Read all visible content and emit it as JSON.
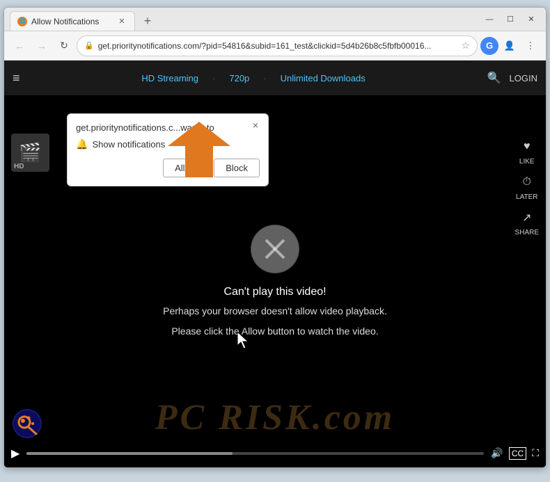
{
  "browser": {
    "tab": {
      "title": "Allow Notifications",
      "favicon": "🌐"
    },
    "new_tab_label": "+",
    "window_controls": {
      "minimize": "—",
      "maximize": "☐",
      "close": "✕"
    },
    "nav": {
      "back": "←",
      "forward": "→",
      "refresh": "↻",
      "address": "get.prioritynotifications.com/?pid=54816&subid=161_test&clickid=5d4b26b8c5fbfb00016...",
      "star": "☆",
      "g_label": "G",
      "profile": "👤",
      "menu": "⋮"
    }
  },
  "site": {
    "hamburger": "≡",
    "features": [
      {
        "label": "HD Streaming"
      },
      {
        "sep": "·"
      },
      {
        "label": "720p"
      },
      {
        "sep": "·"
      },
      {
        "label": "Unlimited Downloads"
      }
    ],
    "search_label": "LOGIN",
    "right_icons": [
      {
        "name": "LIKE"
      },
      {
        "name": "LATER"
      },
      {
        "name": "SHARE"
      }
    ]
  },
  "video": {
    "cant_play": "Can't play this video!",
    "subtext_1": "Perhaps your browser doesn't allow video playback.",
    "subtext_2": "Please click the Allow button to watch the video.",
    "controls": {
      "play": "▶",
      "progress_pct": 45
    }
  },
  "notification_popup": {
    "site_name": "get.prioritynotifications.c...",
    "wants_text": "wants to",
    "show_notifications": "Show notifications",
    "close_icon": "×",
    "allow_label": "Allow",
    "block_label": "Block"
  },
  "watermark": {
    "text": "RISK.com",
    "prefix": "PC"
  },
  "colors": {
    "accent_orange": "#e67e22",
    "arrow_orange": "#e07820",
    "blue_link": "#4fc3f7",
    "address_green": "#5a9e5a"
  }
}
